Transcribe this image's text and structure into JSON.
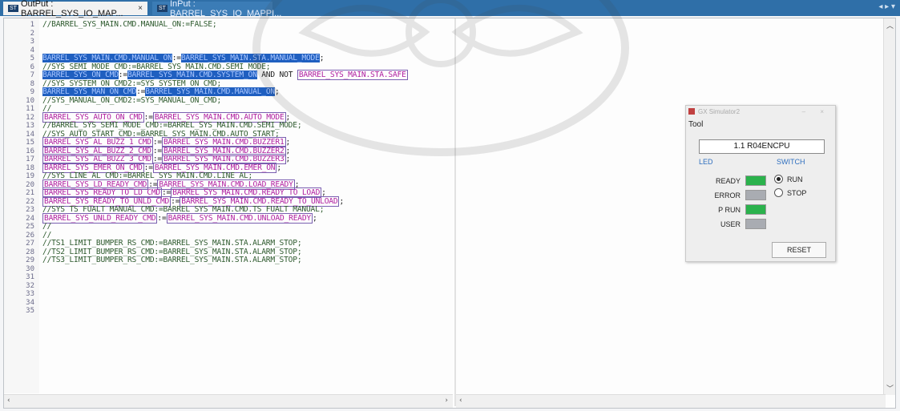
{
  "tabs": [
    {
      "badge": "ST",
      "label": "OutPut : BARREL_SYS_IO_MAP...",
      "close": "×"
    },
    {
      "badge": "ST",
      "label": "InPut : BARREL_SYS_IO_MAPPI..."
    }
  ],
  "line_numbers": [
    "1",
    "2",
    "3",
    "4",
    "5",
    "6",
    "7",
    "8",
    "9",
    "10",
    "11",
    "12",
    "13",
    "14",
    "15",
    "16",
    "17",
    "18",
    "19",
    "20",
    "21",
    "22",
    "23",
    "24",
    "25",
    "26",
    "27",
    "28",
    "29",
    "30",
    "31",
    "32",
    "33",
    "34",
    "35"
  ],
  "code": {
    "l1": "//BARREL_SYS_MAIN.CMD.MANUAL_ON:=FALSE;",
    "l5a": "BARREL_SYS_MAIN.CMD.MANUAL_ON",
    "l5b": ":=",
    "l5c": "BARREL_SYS_MAIN.STA.MANUAL_MODE",
    "l5d": ";",
    "l6": "//SYS_SEMI_MODE_CMD:=BARREL_SYS_MAIN.CMD.SEMI_MODE;",
    "l7a": "BARREL_SYS_ON_CMD",
    "l7b": ":=",
    "l7c": "BARREL_SYS_MAIN.CMD.SYSTEM_ON",
    "l7d": " AND NOT ",
    "l7e": "BARREL_SYS_MAIN.STA.SAFE",
    "l8": "//SYS_SYSTEM_ON_CMD2:=SYS_SYSTEM_ON_CMD;",
    "l9a": "BARREL_SYS_MAN_ON_CMD",
    "l9b": ":=",
    "l9c": "BARREL_SYS_MAIN.CMD.MANUAL_ON",
    "l9d": ";",
    "l10": "//SYS_MANUAL_ON_CMD2:=SYS_MANUAL_ON_CMD;",
    "l11": "//",
    "l12a": "BARREL_SYS_AUTO_ON_CMD",
    "l12b": ":=",
    "l12c": "BARREL_SYS_MAIN.CMD.AUTO_MODE",
    "l12d": ";",
    "l13": "//BARREL_SYS_SEMI_MODE_CMD:=BARREL_SYS_MAIN.CMD.SEMI_MODE;",
    "l14": "//SYS_AUTO_START_CMD:=BARREL_SYS_MAIN.CMD.AUTO_START;",
    "l15a": "BARREL_SYS_AL_BUZZ_1_CMD",
    "l15b": ":=",
    "l15c": "BARREL_SYS_MAIN.CMD.BUZZER1",
    "l15d": ";",
    "l16a": "BARREL_SYS_AL_BUZZ_2_CMD",
    "l16b": ":=",
    "l16c": "BARREL_SYS_MAIN.CMD.BUZZER2",
    "l16d": ";",
    "l17a": "BARREL_SYS_AL_BUZZ_3_CMD",
    "l17b": ":=",
    "l17c": "BARREL_SYS_MAIN.CMD.BUZZER3",
    "l17d": ";",
    "l18a": "BARREL_SYS_EMER_ON_CMD",
    "l18b": ":=",
    "l18c": "BARREL_SYS_MAIN.CMD.EMER_ON",
    "l18d": ";",
    "l19": "//SYS_LINE_AL_CMD:=BARREL_SYS_MAIN.CMD.LINE_AL;",
    "l20a": "BARREL_SYS_LD_READY_CMD",
    "l20b": ":=",
    "l20c": "BARREL_SYS_MAIN.CMD.LOAD_READY",
    "l20d": ";",
    "l21a": "BARREL_SYS_READY_TO_LD_CMD",
    "l21b": ":=",
    "l21c": "BARREL_SYS_MAIN.CMD.READY_TO_LOAD",
    "l21d": ";",
    "l22a": "BARREL_SYS_READY_TO_UNLD_CMD",
    "l22b": ":=",
    "l22c": "BARREL_SYS_MAIN.CMD.READY_TO_UNLOAD",
    "l22d": ";",
    "l23": "//SYS_TS_FUALT_MANUAL_CMD:=BARREL_SYS_MAIN.CMD.TS_FUALT_MANUAL;",
    "l24a": "BARREL_SYS_UNLD_READY_CMD",
    "l24b": ":=",
    "l24c": "BARREL_SYS_MAIN.CMD.UNLOAD_READY",
    "l24d": ";",
    "l25": "//",
    "l26": "//",
    "l27": "//TS1_LIMIT_BUMPER_RS_CMD:=BARREL_SYS_MAIN.STA.ALARM_STOP;",
    "l28": "//TS2_LIMIT_BUMPER_RS_CMD:=BARREL_SYS_MAIN.STA.ALARM_STOP;",
    "l29": "//TS3_LIMIT_BUMPER_RS_CMD:=BARREL_SYS_MAIN.STA.ALARM_STOP;"
  },
  "simulator": {
    "title": "GX Simulator2",
    "menu": "Tool",
    "cpu": "1.1  R04ENCPU",
    "led_header": "LED",
    "switch_header": "SWITCH",
    "leds": [
      {
        "label": "READY",
        "color": "#2bb24c"
      },
      {
        "label": "ERROR",
        "color": "#a9acb2"
      },
      {
        "label": "P RUN",
        "color": "#2bb24c"
      },
      {
        "label": "USER",
        "color": "#a9acb2"
      }
    ],
    "switch_options": [
      "RUN",
      "STOP"
    ],
    "switch_selected": "RUN",
    "reset_label": "RESET"
  },
  "colors": {
    "tab_bar": "#2f6fa8",
    "selection": "#1f5fc0",
    "variable": "#b01ea0",
    "comment": "#2e5a2e"
  }
}
